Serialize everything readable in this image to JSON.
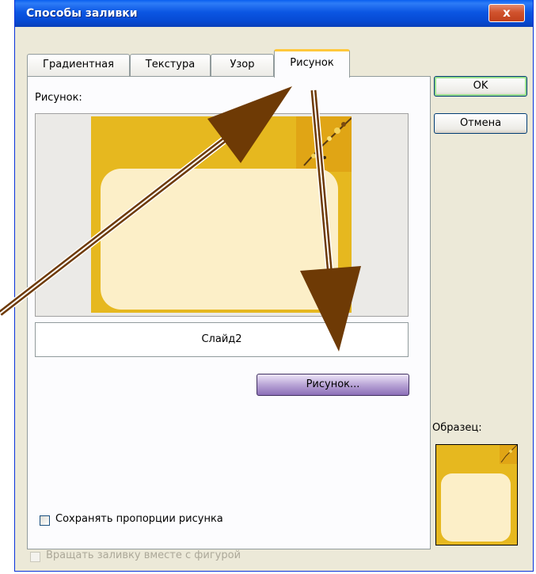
{
  "dialog": {
    "title": "Способы заливки",
    "close_glyph": "x"
  },
  "tabs": [
    {
      "label": "Градиентная",
      "active": false
    },
    {
      "label": "Текстура",
      "active": false
    },
    {
      "label": "Узор",
      "active": false
    },
    {
      "label": "Рисунок",
      "active": true
    }
  ],
  "picture_tab": {
    "picture_label": "Рисунок:",
    "picture_name": "Слайд2",
    "select_picture_button": "Рисунок...",
    "lock_aspect_ratio": {
      "label": "Сохранять пропорции рисунка",
      "checked": false
    },
    "rotate_with_shape": {
      "label": "Вращать заливку вместе с фигурой",
      "checked": false,
      "disabled": true
    }
  },
  "buttons": {
    "ok": "OK",
    "cancel": "Отмена"
  },
  "sample": {
    "label": "Образец:"
  },
  "colors": {
    "titlebar": "#0b56e3",
    "slide_background": "#e6b81f",
    "slide_content": "#fcefc8",
    "arrow": "#6e3a05"
  },
  "icons": [
    "close-icon",
    "checkbox-icon",
    "annotation-arrow"
  ]
}
